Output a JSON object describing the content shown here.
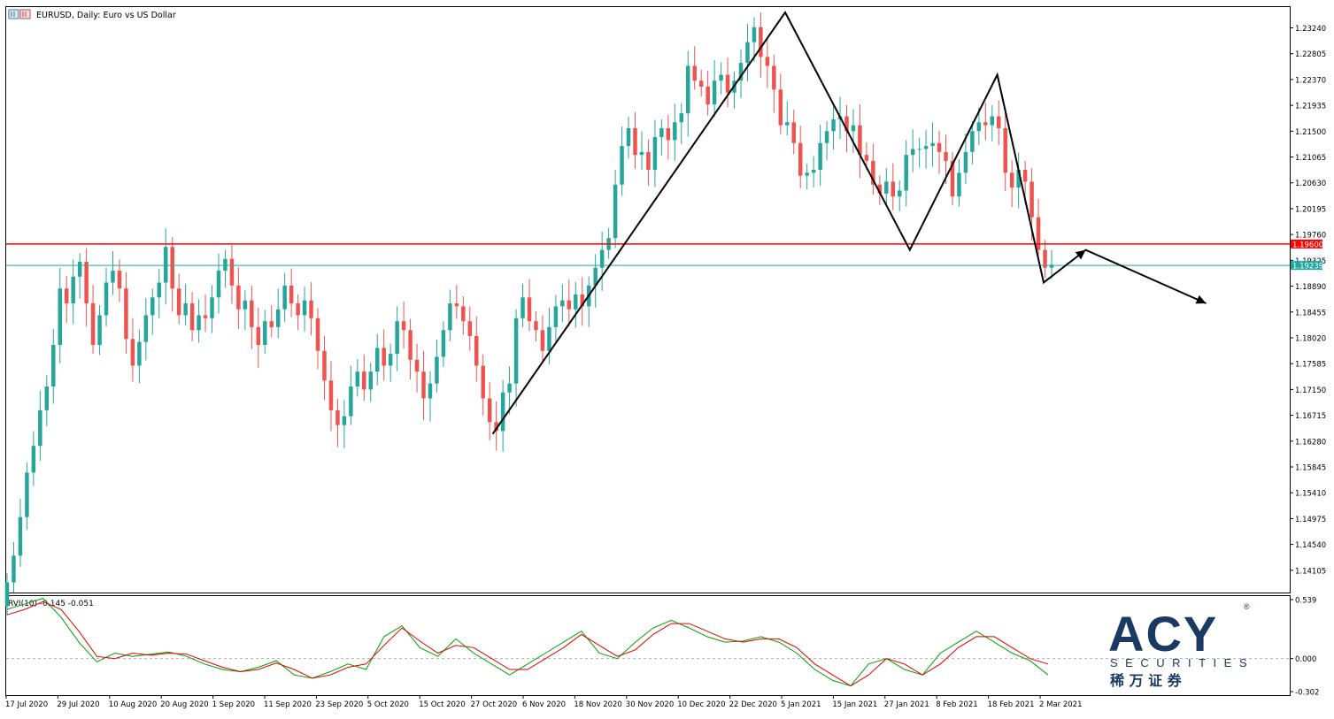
{
  "chart_data": [
    {
      "type": "candlestick",
      "title": "EURUSD, Daily:  Euro vs US Dollar",
      "symbol": "EURUSD",
      "timeframe": "Daily",
      "y_ticks": [
        "1.23240",
        "1.22805",
        "1.22370",
        "1.21935",
        "1.21500",
        "1.21065",
        "1.20630",
        "1.20195",
        "1.19760",
        "1.19325",
        "1.18890",
        "1.18455",
        "1.18020",
        "1.17585",
        "1.17150",
        "1.16715",
        "1.16280",
        "1.15845",
        "1.15410",
        "1.14975",
        "1.14540",
        "1.14105"
      ],
      "ylim": [
        1.1373,
        1.2359
      ],
      "x_ticks": [
        "17 Jul 2020",
        "29 Jul 2020",
        "10 Aug 2020",
        "20 Aug 2020",
        "1 Sep 2020",
        "11 Sep 2020",
        "23 Sep 2020",
        "5 Oct 2020",
        "15 Oct 2020",
        "27 Oct 2020",
        "6 Nov 2020",
        "18 Nov 2020",
        "30 Nov 2020",
        "10 Dec 2020",
        "22 Dec 2020",
        "5 Jan 2021",
        "15 Jan 2021",
        "27 Jan 2021",
        "8 Feb 2021",
        "18 Feb 2021",
        "2 Mar 2021"
      ],
      "candles_close": [
        1.139,
        1.1435,
        1.15,
        1.1575,
        1.162,
        1.168,
        1.172,
        1.179,
        1.1885,
        1.186,
        1.1905,
        1.193,
        1.186,
        1.179,
        1.184,
        1.1895,
        1.1915,
        1.1885,
        1.18,
        1.1755,
        1.1795,
        1.184,
        1.187,
        1.1895,
        1.1955,
        1.1885,
        1.184,
        1.186,
        1.1815,
        1.184,
        1.1835,
        1.187,
        1.1915,
        1.1935,
        1.189,
        1.185,
        1.1865,
        1.182,
        1.179,
        1.183,
        1.182,
        1.185,
        1.189,
        1.186,
        1.184,
        1.1865,
        1.1835,
        1.178,
        1.173,
        1.168,
        1.1655,
        1.167,
        1.172,
        1.1745,
        1.1715,
        1.1745,
        1.1785,
        1.1755,
        1.1775,
        1.183,
        1.1815,
        1.1765,
        1.1745,
        1.17,
        1.1725,
        1.177,
        1.1815,
        1.186,
        1.1855,
        1.183,
        1.1805,
        1.1755,
        1.17,
        1.166,
        1.1645,
        1.171,
        1.1725,
        1.1835,
        1.187,
        1.183,
        1.1815,
        1.178,
        1.182,
        1.1855,
        1.1865,
        1.185,
        1.1875,
        1.1855,
        1.189,
        1.192,
        1.195,
        1.197,
        1.206,
        1.2125,
        1.2155,
        1.211,
        1.2115,
        1.2085,
        1.214,
        1.2155,
        1.2135,
        1.2165,
        1.218,
        1.226,
        1.2235,
        1.2225,
        1.2195,
        1.2235,
        1.2245,
        1.2215,
        1.2235,
        1.2265,
        1.23,
        1.2325,
        1.2275,
        1.226,
        1.222,
        1.216,
        1.2165,
        1.213,
        1.2075,
        1.208,
        1.2085,
        1.213,
        1.215,
        1.217,
        1.2175,
        1.215,
        1.216,
        1.211,
        1.21,
        1.206,
        1.2045,
        1.2065,
        1.204,
        1.205,
        1.211,
        1.212,
        1.212,
        1.2125,
        1.213,
        1.2115,
        1.21,
        1.204,
        1.208,
        1.2115,
        1.215,
        1.2165,
        1.216,
        1.2175,
        1.2155,
        1.208,
        1.2055,
        1.2085,
        1.2065,
        1.2005,
        1.195,
        1.192,
        1.1925
      ]
    },
    {
      "type": "line",
      "title": "RVI(10) -0.145 -0.051",
      "y_ticks": [
        "0.539",
        "0.000",
        "-0.302"
      ],
      "ylim": [
        -0.302,
        0.539
      ],
      "series": [
        {
          "color": "#00a000",
          "values": [
            0.45,
            0.5,
            0.55,
            0.38,
            0.15,
            -0.03,
            0.05,
            0.02,
            0.04,
            0.06,
            0.02,
            -0.05,
            -0.1,
            -0.12,
            -0.08,
            -0.02,
            -0.15,
            -0.18,
            -0.12,
            -0.05,
            -0.1,
            0.2,
            0.3,
            0.1,
            0.02,
            0.18,
            0.05,
            -0.05,
            -0.15,
            -0.05,
            0.05,
            0.15,
            0.25,
            0.05,
            0.0,
            0.15,
            0.28,
            0.35,
            0.28,
            0.2,
            0.15,
            0.16,
            0.2,
            0.15,
            0.05,
            -0.1,
            -0.2,
            -0.25,
            -0.05,
            0.0,
            -0.1,
            -0.15,
            0.05,
            0.15,
            0.25,
            0.15,
            0.05,
            -0.02,
            -0.15
          ]
        },
        {
          "color": "#e00000",
          "values": [
            0.4,
            0.45,
            0.52,
            0.45,
            0.25,
            0.02,
            0.0,
            0.05,
            0.03,
            0.05,
            0.04,
            -0.02,
            -0.08,
            -0.12,
            -0.1,
            -0.04,
            -0.1,
            -0.18,
            -0.15,
            -0.08,
            -0.05,
            0.12,
            0.28,
            0.16,
            0.05,
            0.12,
            0.1,
            0.0,
            -0.1,
            -0.1,
            0.0,
            0.1,
            0.22,
            0.12,
            0.02,
            0.08,
            0.22,
            0.32,
            0.32,
            0.25,
            0.18,
            0.15,
            0.18,
            0.18,
            0.1,
            -0.05,
            -0.15,
            -0.25,
            -0.15,
            0.0,
            -0.05,
            -0.15,
            -0.05,
            0.1,
            0.2,
            0.2,
            0.1,
            0.0,
            -0.05
          ]
        }
      ]
    }
  ],
  "price_lines": [
    {
      "label": "1.19600",
      "value": 1.196,
      "color": "#ff0000"
    },
    {
      "label": "1.19239",
      "value": 1.19239,
      "color": "#20a8a0"
    }
  ],
  "annotations": {
    "zigzag": [
      [
        "27 Oct 2020",
        1.164
      ],
      [
        "5 Jan 2021",
        1.235
      ],
      [
        "27 Jan 2021",
        1.195
      ],
      [
        "18 Feb 2021",
        1.2245
      ],
      [
        "2 Mar 2021",
        1.1895
      ],
      [
        "5 Mar 2021",
        1.195
      ],
      [
        "15 Mar 2021",
        1.186
      ]
    ],
    "color": "#000000"
  },
  "branding": {
    "logo_text": "ACY",
    "registered_mark": "®",
    "subtitle": "SECURITIES",
    "chinese": "稀 万 证 券",
    "color": "#1b3a63"
  },
  "colors": {
    "bull": "#26a69a",
    "bear": "#ef5350",
    "grid_border": "#000000",
    "rvi_green": "#00a000",
    "rvi_red": "#e00000"
  }
}
